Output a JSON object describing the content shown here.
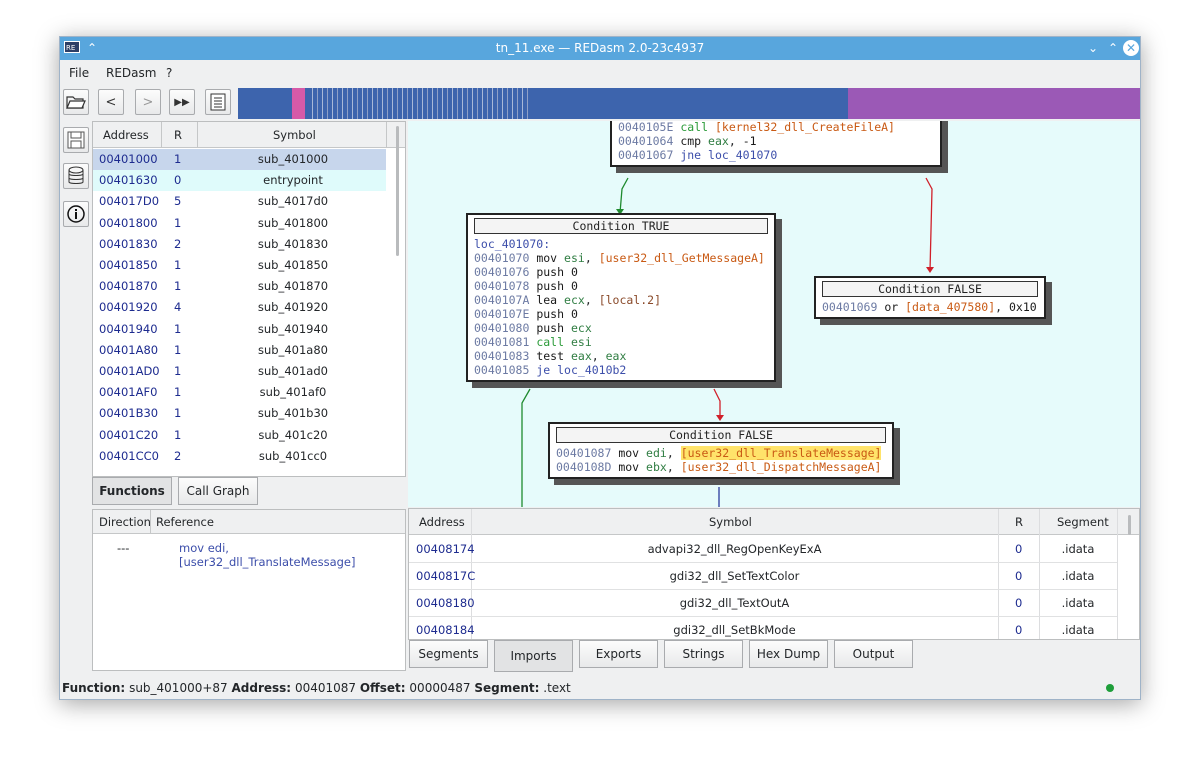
{
  "window": {
    "title": "tn_11.exe — REDasm 2.0-23c4937"
  },
  "menu": [
    "File",
    "REDasm",
    "?"
  ],
  "toolbar": {
    "open_icon": "folder-open-icon",
    "back": "<",
    "forward": ">",
    "goto": "▶▶",
    "list_icon": "list-icon"
  },
  "overview_colors": {
    "base": "#3d64ad",
    "entry": "#d65aa8",
    "data": "#9b59b6"
  },
  "functions": {
    "headers": {
      "address": "Address",
      "r": "R",
      "symbol": "Symbol"
    },
    "rows": [
      {
        "address": "00401000",
        "r": "1",
        "symbol": "sub_401000"
      },
      {
        "address": "00401630",
        "r": "0",
        "symbol": "entrypoint"
      },
      {
        "address": "004017D0",
        "r": "5",
        "symbol": "sub_4017d0"
      },
      {
        "address": "00401800",
        "r": "1",
        "symbol": "sub_401800"
      },
      {
        "address": "00401830",
        "r": "2",
        "symbol": "sub_401830"
      },
      {
        "address": "00401850",
        "r": "1",
        "symbol": "sub_401850"
      },
      {
        "address": "00401870",
        "r": "1",
        "symbol": "sub_401870"
      },
      {
        "address": "00401920",
        "r": "4",
        "symbol": "sub_401920"
      },
      {
        "address": "00401940",
        "r": "1",
        "symbol": "sub_401940"
      },
      {
        "address": "00401A80",
        "r": "1",
        "symbol": "sub_401a80"
      },
      {
        "address": "00401AD0",
        "r": "1",
        "symbol": "sub_401ad0"
      },
      {
        "address": "00401AF0",
        "r": "1",
        "symbol": "sub_401af0"
      },
      {
        "address": "00401B30",
        "r": "1",
        "symbol": "sub_401b30"
      },
      {
        "address": "00401C20",
        "r": "1",
        "symbol": "sub_401c20"
      },
      {
        "address": "00401CC0",
        "r": "2",
        "symbol": "sub_401cc0"
      }
    ]
  },
  "left_tabs": {
    "functions": "Functions",
    "call_graph": "Call Graph"
  },
  "references": {
    "headers": {
      "direction": "Direction",
      "reference": "Reference"
    },
    "rows": [
      {
        "direction": "---",
        "reference": "mov edi, [user32_dll_TranslateMessage]"
      }
    ]
  },
  "graph": {
    "block_top": {
      "lines": [
        {
          "addr": "0040105E",
          "mn": "call",
          "op": "[kernel32_dll_CreateFileA]"
        },
        {
          "addr": "00401064",
          "mn": "cmp",
          "op": "eax, -1"
        },
        {
          "addr": "00401067",
          "mn": "jne",
          "op": "loc_401070"
        }
      ]
    },
    "block_true": {
      "title": "Condition TRUE",
      "label": "loc_401070:",
      "lines": [
        {
          "addr": "00401070",
          "mn": "mov",
          "op": "esi, [user32_dll_GetMessageA]"
        },
        {
          "addr": "00401076",
          "mn": "push",
          "op": "0"
        },
        {
          "addr": "00401078",
          "mn": "push",
          "op": "0"
        },
        {
          "addr": "0040107A",
          "mn": "lea",
          "op": "ecx, [local.2]"
        },
        {
          "addr": "0040107E",
          "mn": "push",
          "op": "0"
        },
        {
          "addr": "00401080",
          "mn": "push",
          "op": "ecx"
        },
        {
          "addr": "00401081",
          "mn": "call",
          "op": "esi"
        },
        {
          "addr": "00401083",
          "mn": "test",
          "op": "eax, eax"
        },
        {
          "addr": "00401085",
          "mn": "je",
          "op": "loc_4010b2"
        }
      ]
    },
    "block_false_right": {
      "title": "Condition FALSE",
      "lines": [
        {
          "addr": "00401069",
          "mn": "or",
          "op": "[data_407580], 0x10"
        }
      ]
    },
    "block_false_bottom": {
      "title": "Condition FALSE",
      "lines": [
        {
          "addr": "00401087",
          "mn": "mov",
          "op": "edi, [user32_dll_TranslateMessage]"
        },
        {
          "addr": "0040108D",
          "mn": "mov",
          "op": "ebx, [user32_dll_DispatchMessageA]"
        }
      ]
    }
  },
  "imports": {
    "headers": {
      "address": "Address",
      "symbol": "Symbol",
      "r": "R",
      "segment": "Segment"
    },
    "rows": [
      {
        "address": "00408174",
        "symbol": "advapi32_dll_RegOpenKeyExA",
        "r": "0",
        "segment": ".idata"
      },
      {
        "address": "0040817C",
        "symbol": "gdi32_dll_SetTextColor",
        "r": "0",
        "segment": ".idata"
      },
      {
        "address": "00408180",
        "symbol": "gdi32_dll_TextOutA",
        "r": "0",
        "segment": ".idata"
      },
      {
        "address": "00408184",
        "symbol": "gdi32_dll_SetBkMode",
        "r": "0",
        "segment": ".idata"
      }
    ]
  },
  "bottom_tabs": [
    "Segments",
    "Imports",
    "Exports",
    "Strings",
    "Hex Dump",
    "Output"
  ],
  "status": {
    "function_label": "Function:",
    "function": "sub_401000+87",
    "address_label": "Address:",
    "address": "00401087",
    "offset_label": "Offset:",
    "offset": "00000487",
    "segment_label": "Segment:",
    "segment": ".text",
    "indicator_color": "#1e9e3a"
  }
}
